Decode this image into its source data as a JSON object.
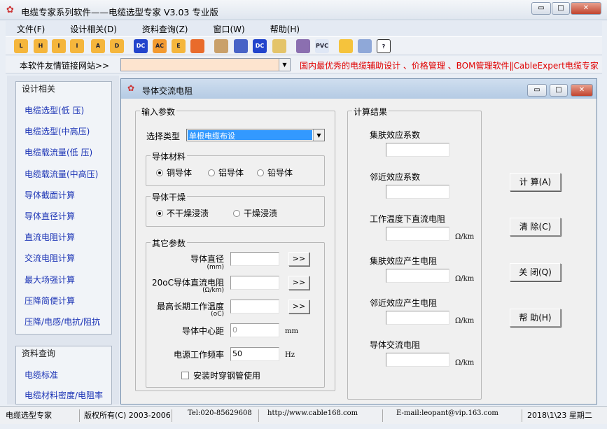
{
  "app": {
    "title": "电缆专家系列软件——电缆选型专家  V3.03 专业版",
    "minimize": "▭",
    "maximize": "□",
    "close": "✕"
  },
  "menu": [
    "文件(F)",
    "设计相关(D)",
    "资料查询(Z)",
    "窗口(W)",
    "帮助(H)"
  ],
  "toolbar": [
    {
      "icon": "zoom-l-icon",
      "label": "L"
    },
    {
      "icon": "zoom-h-icon",
      "label": "H"
    },
    {
      "icon": "current-l-icon",
      "label": "I"
    },
    {
      "icon": "current-h-icon",
      "label": "I"
    },
    {
      "icon": "a-icon",
      "label": "A"
    },
    {
      "icon": "d-icon",
      "label": "D"
    },
    {
      "icon": "dc-icon",
      "label": "DC"
    },
    {
      "icon": "ac-icon",
      "label": "AC"
    },
    {
      "icon": "e-icon",
      "label": "E"
    },
    {
      "icon": "pen-icon",
      "label": ""
    },
    {
      "icon": "clipboard-icon",
      "label": ""
    },
    {
      "icon": "network-icon",
      "label": ""
    },
    {
      "icon": "dc-search-icon",
      "label": "DC"
    },
    {
      "icon": "ruler-icon",
      "label": ""
    },
    {
      "icon": "material-icon",
      "label": ""
    },
    {
      "icon": "pvc-icon",
      "label": "PVC"
    },
    {
      "icon": "key-icon",
      "label": ""
    },
    {
      "icon": "book-icon",
      "label": ""
    },
    {
      "icon": "help-icon",
      "label": "?"
    }
  ],
  "linkbar": {
    "label": "本软件友情链接网站>>",
    "value": "",
    "ad": "国内最优秀的电缆辅助设计 、价格管理 、BOM管理软件‖CableExpert电缆专家"
  },
  "sidebar": {
    "design": {
      "header": "设计相关",
      "items": [
        "电缆选型(低 压)",
        "电缆选型(中高压)",
        "电缆载流量(低 压)",
        "电缆载流量(中高压)",
        "导体截面计算",
        "导体直径计算",
        "直流电阻计算",
        "交流电阻计算",
        "最大场强计算",
        "压降简便计算",
        "压降/电感/电抗/阻抗"
      ]
    },
    "data": {
      "header": "资料查询",
      "items": [
        "电缆标准",
        "电缆材料密度/电阻率"
      ]
    }
  },
  "dialog": {
    "title": "导体交流电阻",
    "input": {
      "header": "输入参数",
      "type_label": "选择类型",
      "type_value": "单根电缆布设",
      "material": {
        "header": "导体材料",
        "options": [
          "铜导体",
          "铝导体",
          "铅导体"
        ],
        "selected": 0
      },
      "dry": {
        "header": "导体干燥",
        "options": [
          "不干燥浸渍",
          "干燥浸渍"
        ],
        "selected": 0
      },
      "other": {
        "header": "其它参数",
        "diameter": {
          "label": "导体直径",
          "unit": "(mm)",
          "value": "",
          "btn": ">>"
        },
        "dcres": {
          "label": "20oC导体直流电阻",
          "unit": "(Ω/km)",
          "value": "",
          "btn": ">>"
        },
        "temp": {
          "label": "最高长期工作温度",
          "unit": "(oC)",
          "value": "",
          "btn": ">>"
        },
        "spacing": {
          "label": "导体中心距",
          "value": "0",
          "unit": "mm"
        },
        "freq": {
          "label": "电源工作频率",
          "value": "50",
          "unit": "Hz"
        },
        "steel": {
          "label": "安装时穿钢管使用",
          "checked": false
        }
      }
    },
    "results": {
      "header": "计算结果",
      "items": [
        {
          "label": "集肤效应系数",
          "unit": ""
        },
        {
          "label": "邻近效应系数",
          "unit": ""
        },
        {
          "label": "工作温度下直流电阻",
          "unit": "Ω/km"
        },
        {
          "label": "集肤效应产生电阻",
          "unit": "Ω/km"
        },
        {
          "label": "邻近效应产生电阻",
          "unit": "Ω/km"
        },
        {
          "label": "导体交流电阻",
          "unit": "Ω/km"
        }
      ]
    },
    "buttons": [
      "计 算(A)",
      "清 除(C)",
      "关 闭(Q)",
      "帮 助(H)"
    ]
  },
  "status": [
    "电缆选型专家",
    "版权所有(C) 2003-2006",
    "Tel:020-85629608",
    "http://www.cable168.com",
    "E-mail:leopant@vip.163.com",
    "2018\\1\\23 星期二"
  ]
}
